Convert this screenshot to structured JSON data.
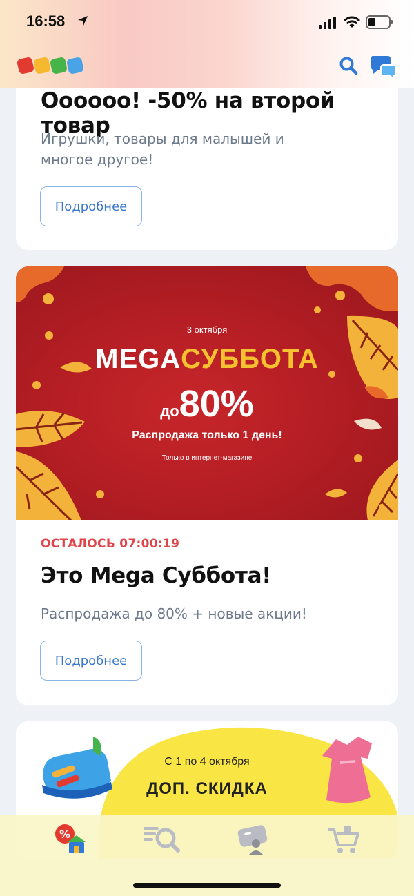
{
  "status_bar": {
    "time": "16:58"
  },
  "header": {
    "search_icon": "search-icon",
    "chat_icon": "chat-icon"
  },
  "promo_cards": [
    {
      "title": "Оооооо! -50% на второй товар",
      "subtitle": "Игрушки, товары для малышей и многое другое!",
      "button": "Подробнее"
    },
    {
      "banner": {
        "date": "3 октября",
        "headline_a": "MEGA",
        "headline_b": "СУББОТА",
        "prefix": "до",
        "percent": "80%",
        "sale_line": "Распродажа только 1 день!",
        "note": "Только в интернет-магазине"
      },
      "timer": "ОСТАЛОСЬ 07:00:19",
      "title": "Это Mega Суббота!",
      "subtitle": "Распродажа до 80% + новые акции!",
      "button": "Подробнее"
    },
    {
      "banner": {
        "date": "С 1 по 4 октября",
        "title": "ДОП. СКИДКА"
      }
    }
  ],
  "tabs": [
    {
      "name": "promotions",
      "icon": "percent-store-icon",
      "active": true
    },
    {
      "name": "catalog-search",
      "icon": "catalog-search-icon",
      "active": false
    },
    {
      "name": "profile",
      "icon": "profile-card-icon",
      "active": false
    },
    {
      "name": "cart",
      "icon": "cart-icon",
      "active": false
    }
  ],
  "colors": {
    "accent_blue": "#3d78c8",
    "timer_red": "#e0454a",
    "banner_red": "#b41e24",
    "banner_yellow": "#f6c130"
  }
}
